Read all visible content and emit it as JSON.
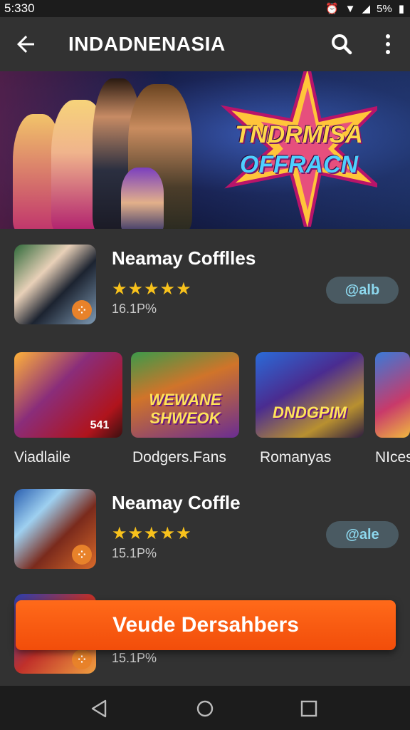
{
  "status": {
    "time": "5:330",
    "battery_text": "5%"
  },
  "appbar": {
    "title": "INDADNENASIA",
    "back_icon": "arrow-back-icon",
    "search_icon": "search-icon",
    "more_icon": "more-vert-icon"
  },
  "banner": {
    "headline_line1": "TNDRMISA",
    "headline_line2": "OFFRACN"
  },
  "apps": [
    {
      "name": "Neamay Cofflles",
      "rating": 5,
      "meta": "16.1P%",
      "button": "@alb",
      "badge_icon": "grid-dots-icon"
    },
    {
      "name": "Neamay Coffle",
      "rating": 5,
      "meta": "15.1P%",
      "button": "@ale",
      "badge_icon": "grid-dots-icon"
    },
    {
      "name": "",
      "rating": 0,
      "meta": "15.1P%",
      "button": "",
      "badge_icon": "grid-dots-icon"
    }
  ],
  "tiles": [
    {
      "label": "Viadlaile",
      "art_text": "",
      "corner_text": "541"
    },
    {
      "label": "Dodgers.Fans",
      "art_text": "WEWANE SHWEOK",
      "corner_text": ""
    },
    {
      "label": "Romanyas",
      "art_text": "DNDGPIM",
      "corner_text": ""
    },
    {
      "label": "NIces",
      "art_text": "",
      "corner_text": ""
    }
  ],
  "cta": {
    "label": "Veude Dersahbers"
  },
  "nav": {
    "back": "nav-back-icon",
    "home": "nav-home-icon",
    "recents": "nav-recents-icon"
  },
  "colors": {
    "accent": "#f2550d",
    "star": "#f8c21c",
    "pill_text": "#8dd8ee"
  }
}
